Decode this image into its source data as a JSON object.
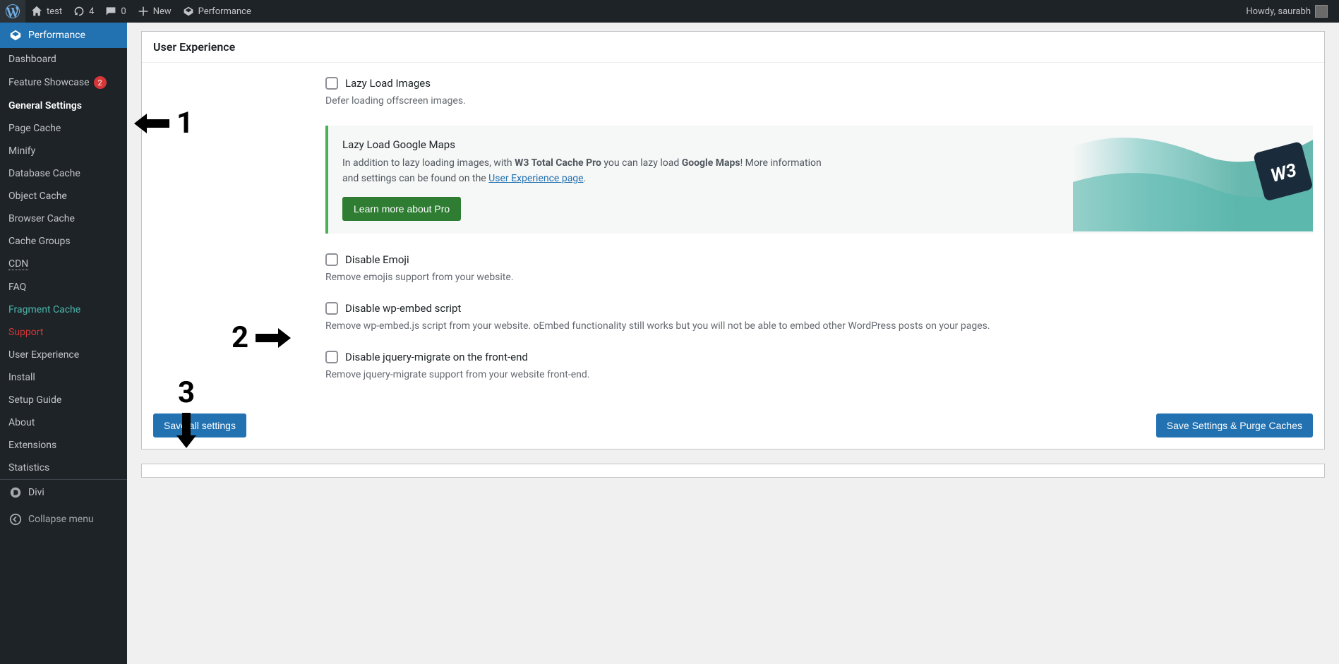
{
  "adminbar": {
    "site_name": "test",
    "updates_count": "4",
    "comments_count": "0",
    "new_label": "New",
    "performance_label": "Performance",
    "howdy": "Howdy, saurabh"
  },
  "sidebar": {
    "header": "Performance",
    "items": [
      {
        "label": "Dashboard"
      },
      {
        "label": "Feature Showcase",
        "badge": "2"
      },
      {
        "label": "General Settings",
        "current": true
      },
      {
        "label": "Page Cache"
      },
      {
        "label": "Minify"
      },
      {
        "label": "Database Cache"
      },
      {
        "label": "Object Cache"
      },
      {
        "label": "Browser Cache"
      },
      {
        "label": "Cache Groups"
      },
      {
        "label": "CDN",
        "dotted": true
      },
      {
        "label": "FAQ"
      },
      {
        "label": "Fragment Cache",
        "cls": "fragment"
      },
      {
        "label": "Support",
        "cls": "support"
      },
      {
        "label": "User Experience"
      },
      {
        "label": "Install"
      },
      {
        "label": "Setup Guide"
      },
      {
        "label": "About"
      },
      {
        "label": "Extensions"
      },
      {
        "label": "Statistics"
      }
    ],
    "divi": "Divi",
    "collapse": "Collapse menu"
  },
  "panel": {
    "title": "User Experience",
    "lazy_images": {
      "label": "Lazy Load Images",
      "desc": "Defer loading offscreen images."
    },
    "promo": {
      "title": "Lazy Load Google Maps",
      "text_pre": "In addition to lazy loading images, with ",
      "bold1": "W3 Total Cache Pro",
      "text_mid": " you can lazy load ",
      "bold2": "Google Maps",
      "text_post": "! More information and settings can be found on the ",
      "link": "User Experience page",
      "button": "Learn more about Pro"
    },
    "disable_emoji": {
      "label": "Disable Emoji",
      "desc": "Remove emojis support from your website."
    },
    "disable_wpembed": {
      "label": "Disable wp-embed script",
      "desc": "Remove wp-embed.js script from your website. oEmbed functionality still works but you will not be able to embed other WordPress posts on your pages."
    },
    "disable_jqmigrate": {
      "label": "Disable jquery-migrate on the front-end",
      "desc": "Remove jquery-migrate support from your website front-end."
    },
    "save_btn": "Save all settings",
    "purge_btn": "Save Settings & Purge Caches"
  },
  "annotations": {
    "a1": "1",
    "a2": "2",
    "a3": "3"
  }
}
